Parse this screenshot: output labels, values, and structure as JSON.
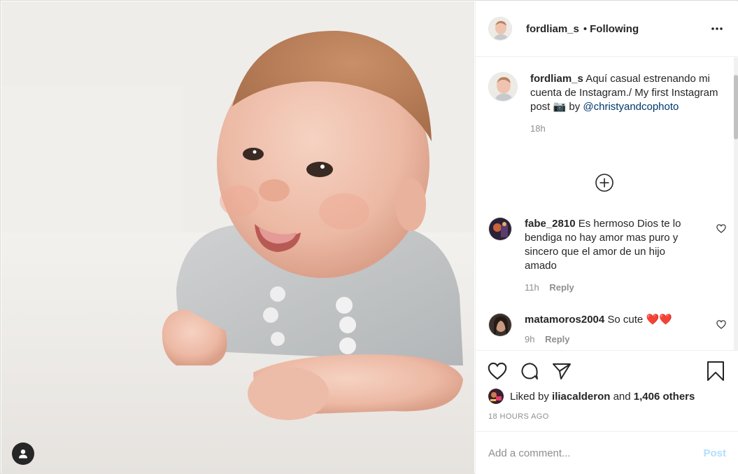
{
  "post": {
    "author": "fordliam_s",
    "follow_status": "Following",
    "separator": "•",
    "timestamp": "18 HOURS AGO"
  },
  "caption": {
    "username": "fordliam_s",
    "text_before_emoji": "Aquí casual estrenando mi cuenta de Instagram./ My first Instagram post",
    "emoji": "📷",
    "by": "by",
    "mention": "@christyandcophoto",
    "time": "18h"
  },
  "comments": [
    {
      "username": "fabe_2810",
      "text": "Es hermoso Dios te lo bendiga no hay amor mas puro y sincero que el amor de un hijo amado",
      "time": "11h",
      "reply_label": "Reply"
    },
    {
      "username": "matamoros2004",
      "text": "So cute",
      "hearts": "❤️❤️",
      "time": "9h",
      "reply_label": "Reply"
    }
  ],
  "likes": {
    "prefix": "Liked by",
    "user": "iliacalderon",
    "conjunction": "and",
    "others": "1,406 others"
  },
  "add_comment": {
    "placeholder": "Add a comment...",
    "post_label": "Post"
  },
  "icons": {
    "more": "more-dots-icon",
    "load_more": "plus-circle-icon",
    "like": "heart-icon",
    "comment": "comment-bubble-icon",
    "share": "paper-plane-icon",
    "save": "bookmark-icon",
    "tags": "user-tag-icon"
  },
  "colors": {
    "link": "#00376b",
    "post_button_disabled": "#b2dffc",
    "secondary_text": "#8e8e8e",
    "heart_red": "#ed4956"
  }
}
